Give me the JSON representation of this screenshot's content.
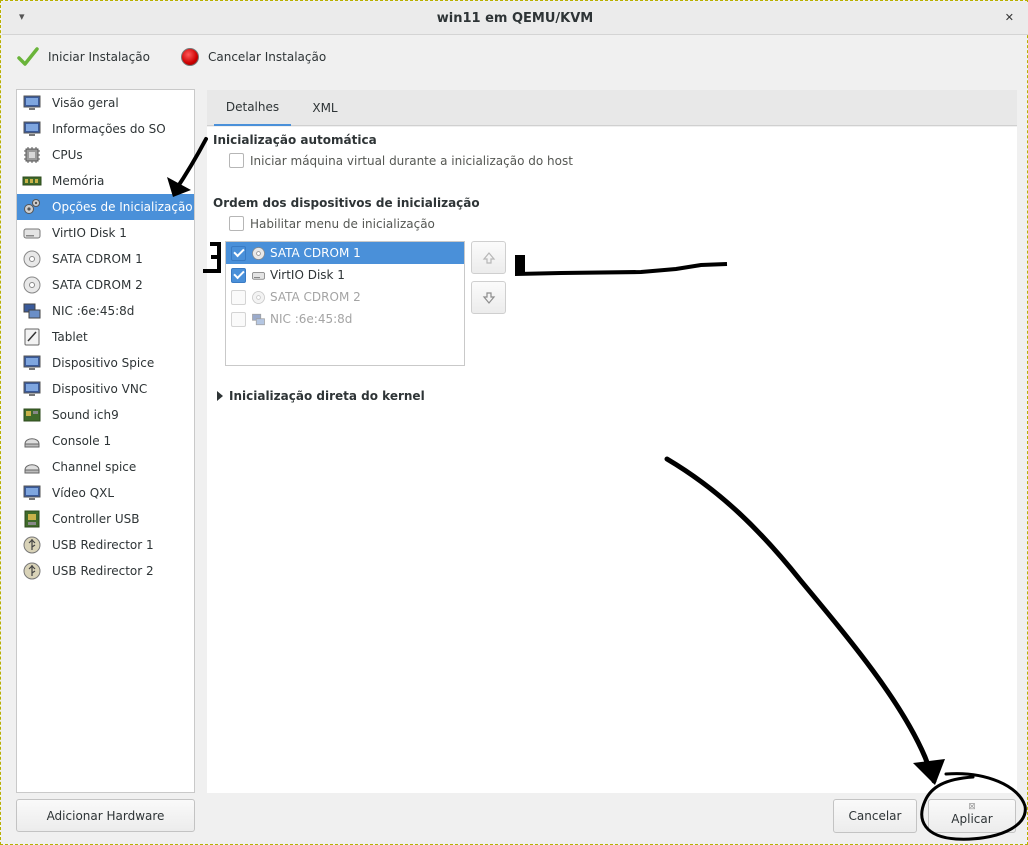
{
  "window": {
    "title": "win11 em QEMU/KVM",
    "menu_glyph": "▾",
    "close_glyph": "✕"
  },
  "toolbar": {
    "begin_install": {
      "label": "Iniciar Instalação",
      "icon": "check-icon"
    },
    "cancel_install": {
      "label": "Cancelar Instalação",
      "icon": "stop-icon"
    }
  },
  "sidebar": {
    "selected_index": 4,
    "items": [
      {
        "label": "Visão geral",
        "icon": "monitor-icon"
      },
      {
        "label": "Informações do SO",
        "icon": "monitor-icon"
      },
      {
        "label": "CPUs",
        "icon": "cpu-icon"
      },
      {
        "label": "Memória",
        "icon": "memory-icon"
      },
      {
        "label": "Opções de Inicialização",
        "icon": "gears-icon"
      },
      {
        "label": "VirtIO Disk 1",
        "icon": "disk-icon"
      },
      {
        "label": "SATA CDROM 1",
        "icon": "cdrom-icon"
      },
      {
        "label": "SATA CDROM 2",
        "icon": "cdrom-icon"
      },
      {
        "label": "NIC :6e:45:8d",
        "icon": "network-icon"
      },
      {
        "label": "Tablet",
        "icon": "tablet-icon"
      },
      {
        "label": "Dispositivo Spice",
        "icon": "monitor-icon"
      },
      {
        "label": "Dispositivo VNC",
        "icon": "monitor-icon"
      },
      {
        "label": "Sound ich9",
        "icon": "sound-card-icon"
      },
      {
        "label": "Console 1",
        "icon": "serial-icon"
      },
      {
        "label": "Channel spice",
        "icon": "serial-icon"
      },
      {
        "label": "Vídeo QXL",
        "icon": "monitor-icon"
      },
      {
        "label": "Controller USB",
        "icon": "controller-icon"
      },
      {
        "label": "USB Redirector 1",
        "icon": "usb-icon"
      },
      {
        "label": "USB Redirector 2",
        "icon": "usb-icon"
      }
    ],
    "add_hardware_label": "Adicionar Hardware"
  },
  "tabs": [
    {
      "label": "Detalhes",
      "active": true
    },
    {
      "label": "XML",
      "active": false
    }
  ],
  "boot": {
    "autostart_title": "Inicialização automática",
    "autostart_label": "Iniciar máquina virtual durante a inicialização do host",
    "autostart_checked": false,
    "order_title": "Ordem dos dispositivos de inicialização",
    "menu_label": "Habilitar menu de inicialização",
    "menu_checked": false,
    "devices": [
      {
        "label": "SATA CDROM 1",
        "checked": true,
        "selected": true,
        "icon": "cdrom-icon"
      },
      {
        "label": "VirtIO Disk 1",
        "checked": true,
        "selected": false,
        "icon": "disk-icon"
      },
      {
        "label": "SATA CDROM 2",
        "checked": false,
        "selected": false,
        "icon": "cdrom-icon"
      },
      {
        "label": "NIC :6e:45:8d",
        "checked": false,
        "selected": false,
        "icon": "network-icon"
      }
    ],
    "kernel_title": "Inicialização direta do kernel"
  },
  "footer": {
    "cancel_label": "Cancelar",
    "apply_label": "Aplicar"
  },
  "colors": {
    "selection": "#4a90d9",
    "ink": "#000000"
  }
}
